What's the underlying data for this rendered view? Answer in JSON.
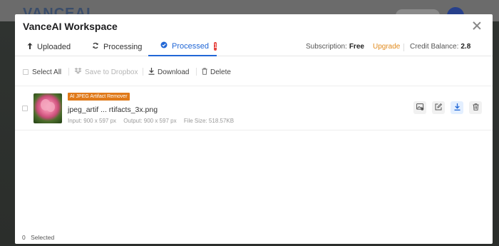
{
  "background": {
    "logo_text": "VANCEAI"
  },
  "modal": {
    "title": "VanceAI Workspace",
    "close_icon": "close-icon"
  },
  "tabs": [
    {
      "label": "Uploaded",
      "icon": "upload-arrow-icon",
      "active": false
    },
    {
      "label": "Processing",
      "icon": "refresh-icon",
      "active": false
    },
    {
      "label": "Processed",
      "icon": "check-circle-icon",
      "active": true,
      "badge": "1"
    }
  ],
  "subscription": {
    "label": "Subscription:",
    "plan": "Free",
    "upgrade_label": "Upgrade",
    "credit_label": "Credit Balance:",
    "credit_value": "2.8"
  },
  "toolbar": {
    "select_all": "Select All",
    "save_dropbox": "Save to Dropbox",
    "download": "Download",
    "delete": "Delete"
  },
  "files": [
    {
      "tag": "AI JPEG Artifact Remover",
      "name": "jpeg_artif ... rtifacts_3x.png",
      "input": "Input: 900 x 597 px",
      "output": "Output: 900 x 597 px",
      "size": "File Size: 518.57KB"
    }
  ],
  "footer": {
    "count": "0",
    "label": "Selected"
  },
  "colors": {
    "accent": "#2167d6",
    "upgrade": "#e08a1d",
    "tag": "#e07a1a",
    "badge": "#e6433e"
  }
}
